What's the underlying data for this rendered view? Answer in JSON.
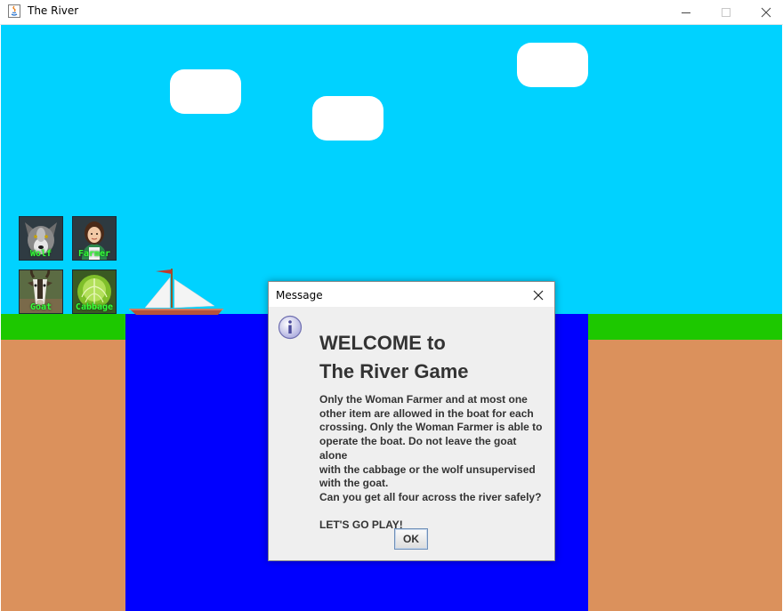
{
  "window": {
    "title": "The River",
    "controls": [
      "minimize",
      "maximize",
      "close"
    ]
  },
  "game": {
    "colors": {
      "sky": "#00d2ff",
      "river": "#0000ff",
      "grass": "#1dc800",
      "dirt": "#db915c",
      "cloud": "#ffffff",
      "label": "#35ff3a"
    },
    "characters": [
      {
        "id": "wolf",
        "label": "Wolf",
        "icon": "wolf-icon"
      },
      {
        "id": "farmer",
        "label": "Farmer",
        "icon": "farmer-icon"
      },
      {
        "id": "goat",
        "label": "Goat",
        "icon": "goat-icon"
      },
      {
        "id": "cabbage",
        "label": "Cabbage",
        "icon": "cabbage-icon"
      }
    ],
    "boat": {
      "icon": "sailboat-icon"
    }
  },
  "dialog": {
    "title": "Message",
    "heading_line1": "WELCOME to",
    "heading_line2": "The River Game",
    "body": [
      "Only the Woman Farmer and at most one",
      "other item are allowed in the boat for each",
      "crossing. Only the Woman Farmer is able to",
      "operate the boat. Do not leave the goat alone",
      "with the cabbage or the wolf unsupervised",
      "with the goat.",
      "Can you get all four across the river safely?"
    ],
    "closing": "LET'S GO PLAY!",
    "ok_label": "OK",
    "icon": "info-icon"
  }
}
